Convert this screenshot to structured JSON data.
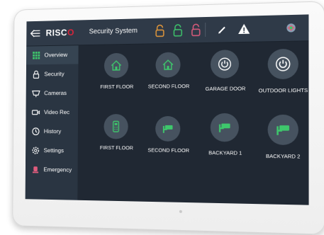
{
  "topbar": {
    "logo_main": "RISC",
    "logo_accent": "O",
    "title": "Security System",
    "icons": [
      "back-arrow-icon",
      "lock-open-orange-icon",
      "lock-open-green-icon",
      "lock-open-pink-icon",
      "pencil-icon",
      "alert-triangle-icon",
      "user-avatar-icon"
    ]
  },
  "sidebar": {
    "items": [
      {
        "label": "Overview",
        "icon": "grid-icon",
        "active": true
      },
      {
        "label": "Security",
        "icon": "lock-icon",
        "active": false
      },
      {
        "label": "Cameras",
        "icon": "camera-icon",
        "active": false
      },
      {
        "label": "Video Rec",
        "icon": "video-icon",
        "active": false
      },
      {
        "label": "History",
        "icon": "history-icon",
        "active": false
      },
      {
        "label": "Settings",
        "icon": "gear-icon",
        "active": false
      },
      {
        "label": "Emergency",
        "icon": "emergency-icon",
        "active": false
      }
    ]
  },
  "tiles": [
    {
      "label": "FIRST FLOOR",
      "icon": "home-icon"
    },
    {
      "label": "SECOND FLOOR",
      "icon": "home-icon"
    },
    {
      "label": "GARAGE DOOR",
      "icon": "power-icon"
    },
    {
      "label": "OUTDOOR LIGHTS",
      "icon": "power-icon"
    },
    {
      "label": "FIRST FLOOR",
      "icon": "keypad-icon"
    },
    {
      "label": "SECOND FLOOR",
      "icon": "camera-icon"
    },
    {
      "label": "BACKYARD 1",
      "icon": "camera-icon"
    },
    {
      "label": "BACKYARD 2",
      "icon": "camera-icon"
    }
  ],
  "colors": {
    "accent_green": "#3ec76c",
    "accent_orange": "#e89a3a",
    "accent_pink": "#e05c7d",
    "brand_red": "#d9253b",
    "screen_bg": "#202833"
  }
}
